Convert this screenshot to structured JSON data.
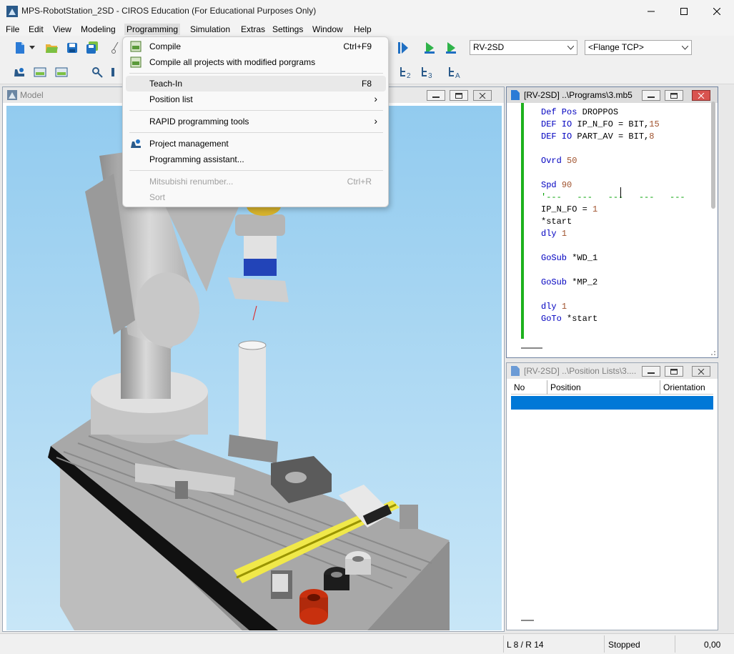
{
  "titlebar": {
    "title": "MPS-RobotStation_2SD - CIROS Education (For Educational Purposes Only)"
  },
  "menu": [
    "File",
    "Edit",
    "View",
    "Modeling",
    "Programming",
    "Simulation",
    "Extras",
    "Settings",
    "Window",
    "Help"
  ],
  "toolbar": {
    "robot_combo": "RV-2SD",
    "tcp_combo": "<Flange TCP>",
    "icon_label_2": "2",
    "icon_label_3": "3",
    "icon_label_a": "A"
  },
  "programming_menu": {
    "compile": "Compile",
    "compile_sc": "Ctrl+F9",
    "compile_all": "Compile all projects with modified porgrams",
    "teach_in": "Teach-In",
    "teach_in_sc": "F8",
    "position_list": "Position list",
    "rapid_tools": "RAPID programming tools",
    "project_mgmt": "Project management",
    "prog_assistant": "Programming assistant...",
    "renumber": "Mitsubishi renumber...",
    "renumber_sc": "Ctrl+R",
    "sort": "Sort"
  },
  "model_window": {
    "title": "Model"
  },
  "program_window": {
    "title": "[RV-2SD] ..\\Programs\\3.mb5",
    "lines": [
      {
        "kw": "Def Pos",
        "rest": " DROPPOS"
      },
      {
        "kw": "DEF IO",
        "rest": " IP_N_FO = BIT,",
        "num": "15"
      },
      {
        "kw": "DEF IO",
        "rest": " PART_AV = BIT,",
        "num": "8"
      },
      {
        "kw": "Ovrd",
        "rest": " ",
        "num": "50"
      },
      {
        "kw": "Spd",
        "rest": " ",
        "num": "90"
      },
      {
        "cmt": "'---   ---   ---   ---   ---"
      },
      {
        "text": "IP_N_FO = ",
        "num": "1"
      },
      {
        "text": "*start"
      },
      {
        "kw": "dly",
        "rest": " ",
        "num": "1"
      },
      {
        "kw": "GoSub",
        "rest": " *WD_1"
      },
      {
        "kw": "GoSub",
        "rest": " *MP_2"
      },
      {
        "kw": "dly",
        "rest": " ",
        "num": "1"
      },
      {
        "kw": "GoTo",
        "rest": " *start"
      }
    ]
  },
  "position_window": {
    "title": "[RV-2SD] ..\\Position Lists\\3....",
    "columns": [
      "No",
      "Position",
      "Orientation"
    ]
  },
  "status": {
    "cursor": "L 8 / R 14",
    "state": "Stopped",
    "time": "0,00"
  },
  "colors": {
    "selection": "#0078d7",
    "keyword": "#0000c0",
    "comment": "#00a000",
    "number": "#a0522d",
    "gutter": "#1db11d"
  }
}
